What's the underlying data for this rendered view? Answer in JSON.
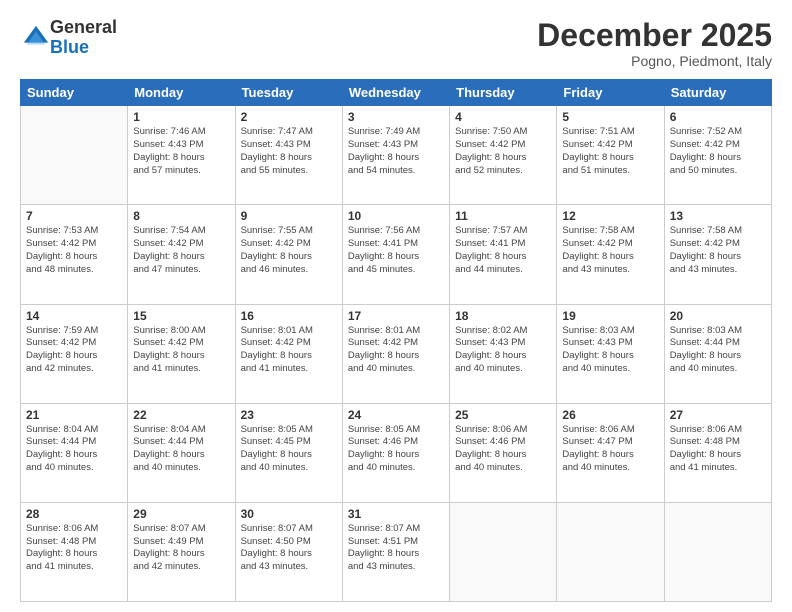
{
  "header": {
    "logo": {
      "general": "General",
      "blue": "Blue"
    },
    "title": "December 2025",
    "location": "Pogno, Piedmont, Italy"
  },
  "days_of_week": [
    "Sunday",
    "Monday",
    "Tuesday",
    "Wednesday",
    "Thursday",
    "Friday",
    "Saturday"
  ],
  "weeks": [
    [
      {
        "day": "",
        "info": ""
      },
      {
        "day": "1",
        "info": "Sunrise: 7:46 AM\nSunset: 4:43 PM\nDaylight: 8 hours\nand 57 minutes."
      },
      {
        "day": "2",
        "info": "Sunrise: 7:47 AM\nSunset: 4:43 PM\nDaylight: 8 hours\nand 55 minutes."
      },
      {
        "day": "3",
        "info": "Sunrise: 7:49 AM\nSunset: 4:43 PM\nDaylight: 8 hours\nand 54 minutes."
      },
      {
        "day": "4",
        "info": "Sunrise: 7:50 AM\nSunset: 4:42 PM\nDaylight: 8 hours\nand 52 minutes."
      },
      {
        "day": "5",
        "info": "Sunrise: 7:51 AM\nSunset: 4:42 PM\nDaylight: 8 hours\nand 51 minutes."
      },
      {
        "day": "6",
        "info": "Sunrise: 7:52 AM\nSunset: 4:42 PM\nDaylight: 8 hours\nand 50 minutes."
      }
    ],
    [
      {
        "day": "7",
        "info": "Sunrise: 7:53 AM\nSunset: 4:42 PM\nDaylight: 8 hours\nand 48 minutes."
      },
      {
        "day": "8",
        "info": "Sunrise: 7:54 AM\nSunset: 4:42 PM\nDaylight: 8 hours\nand 47 minutes."
      },
      {
        "day": "9",
        "info": "Sunrise: 7:55 AM\nSunset: 4:42 PM\nDaylight: 8 hours\nand 46 minutes."
      },
      {
        "day": "10",
        "info": "Sunrise: 7:56 AM\nSunset: 4:41 PM\nDaylight: 8 hours\nand 45 minutes."
      },
      {
        "day": "11",
        "info": "Sunrise: 7:57 AM\nSunset: 4:41 PM\nDaylight: 8 hours\nand 44 minutes."
      },
      {
        "day": "12",
        "info": "Sunrise: 7:58 AM\nSunset: 4:42 PM\nDaylight: 8 hours\nand 43 minutes."
      },
      {
        "day": "13",
        "info": "Sunrise: 7:58 AM\nSunset: 4:42 PM\nDaylight: 8 hours\nand 43 minutes."
      }
    ],
    [
      {
        "day": "14",
        "info": "Sunrise: 7:59 AM\nSunset: 4:42 PM\nDaylight: 8 hours\nand 42 minutes."
      },
      {
        "day": "15",
        "info": "Sunrise: 8:00 AM\nSunset: 4:42 PM\nDaylight: 8 hours\nand 41 minutes."
      },
      {
        "day": "16",
        "info": "Sunrise: 8:01 AM\nSunset: 4:42 PM\nDaylight: 8 hours\nand 41 minutes."
      },
      {
        "day": "17",
        "info": "Sunrise: 8:01 AM\nSunset: 4:42 PM\nDaylight: 8 hours\nand 40 minutes."
      },
      {
        "day": "18",
        "info": "Sunrise: 8:02 AM\nSunset: 4:43 PM\nDaylight: 8 hours\nand 40 minutes."
      },
      {
        "day": "19",
        "info": "Sunrise: 8:03 AM\nSunset: 4:43 PM\nDaylight: 8 hours\nand 40 minutes."
      },
      {
        "day": "20",
        "info": "Sunrise: 8:03 AM\nSunset: 4:44 PM\nDaylight: 8 hours\nand 40 minutes."
      }
    ],
    [
      {
        "day": "21",
        "info": "Sunrise: 8:04 AM\nSunset: 4:44 PM\nDaylight: 8 hours\nand 40 minutes."
      },
      {
        "day": "22",
        "info": "Sunrise: 8:04 AM\nSunset: 4:44 PM\nDaylight: 8 hours\nand 40 minutes."
      },
      {
        "day": "23",
        "info": "Sunrise: 8:05 AM\nSunset: 4:45 PM\nDaylight: 8 hours\nand 40 minutes."
      },
      {
        "day": "24",
        "info": "Sunrise: 8:05 AM\nSunset: 4:46 PM\nDaylight: 8 hours\nand 40 minutes."
      },
      {
        "day": "25",
        "info": "Sunrise: 8:06 AM\nSunset: 4:46 PM\nDaylight: 8 hours\nand 40 minutes."
      },
      {
        "day": "26",
        "info": "Sunrise: 8:06 AM\nSunset: 4:47 PM\nDaylight: 8 hours\nand 40 minutes."
      },
      {
        "day": "27",
        "info": "Sunrise: 8:06 AM\nSunset: 4:48 PM\nDaylight: 8 hours\nand 41 minutes."
      }
    ],
    [
      {
        "day": "28",
        "info": "Sunrise: 8:06 AM\nSunset: 4:48 PM\nDaylight: 8 hours\nand 41 minutes."
      },
      {
        "day": "29",
        "info": "Sunrise: 8:07 AM\nSunset: 4:49 PM\nDaylight: 8 hours\nand 42 minutes."
      },
      {
        "day": "30",
        "info": "Sunrise: 8:07 AM\nSunset: 4:50 PM\nDaylight: 8 hours\nand 43 minutes."
      },
      {
        "day": "31",
        "info": "Sunrise: 8:07 AM\nSunset: 4:51 PM\nDaylight: 8 hours\nand 43 minutes."
      },
      {
        "day": "",
        "info": ""
      },
      {
        "day": "",
        "info": ""
      },
      {
        "day": "",
        "info": ""
      }
    ]
  ]
}
